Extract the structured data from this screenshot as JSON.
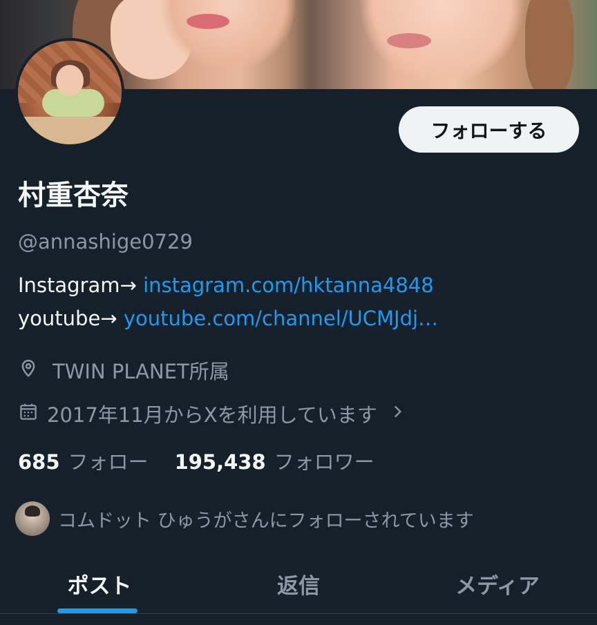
{
  "profile": {
    "display_name": "村重杏奈",
    "handle": "@annashige0729",
    "follow_button": "フォローする"
  },
  "bio": {
    "line1_prefix": "Instagram→ ",
    "line1_link": "instagram.com/hktanna4848",
    "line2_prefix": "youtube→ ",
    "line2_link": "youtube.com/channel/UCMJdj…"
  },
  "meta": {
    "location": "TWIN PLANET所属",
    "joined": "2017年11月からXを利用しています",
    "location_icon": "location-pin-icon",
    "calendar_icon": "calendar-icon",
    "chevron_icon": "chevron-right-icon"
  },
  "stats": {
    "following_count": "685",
    "following_label": "フォロー",
    "followers_count": "195,438",
    "followers_label": "フォロワー"
  },
  "followed_by": {
    "text": "コムドット ひゅうがさんにフォローされています"
  },
  "tabs": [
    {
      "label": "ポスト",
      "active": true
    },
    {
      "label": "返信",
      "active": false
    },
    {
      "label": "メディア",
      "active": false
    }
  ],
  "colors": {
    "background": "#15202b",
    "accent": "#1d9bf0",
    "secondary_text": "#8b98a5",
    "primary_text": "#f7f9f9"
  }
}
